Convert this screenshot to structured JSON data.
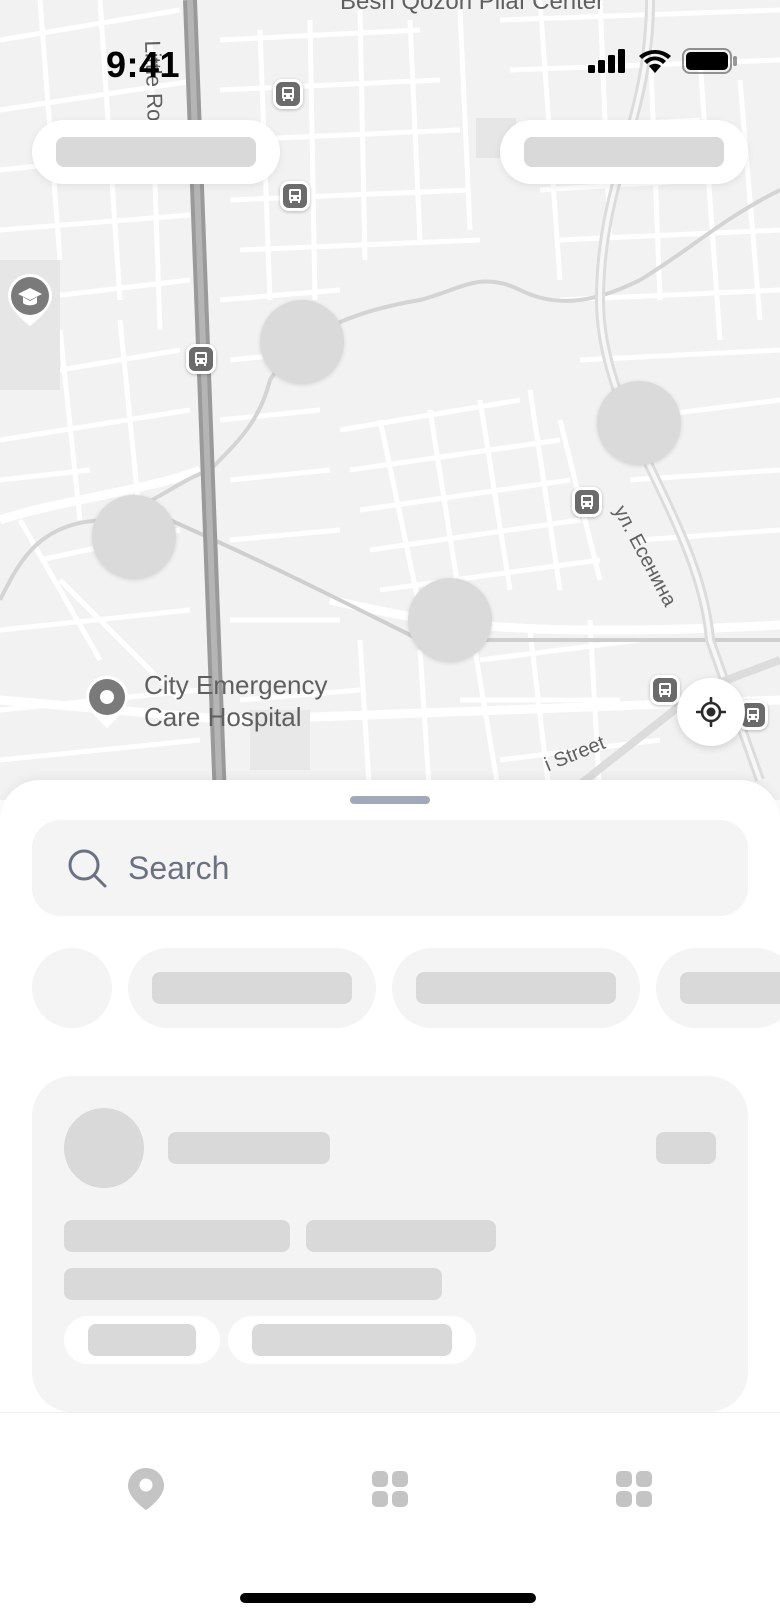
{
  "status_bar": {
    "time": "9:41"
  },
  "map": {
    "labels": {
      "hospital_line1": "City Emergency",
      "hospital_line2": "Care Hospital",
      "street_little": "Little Road",
      "street_esenina": "ул. Есенина",
      "street_bottom": "i Street",
      "top_center": "Besh Qozon Pilaf Center"
    },
    "icons": {
      "bus_stop": "bus-icon",
      "school": "graduation-cap-icon",
      "hospital": "location-pin-icon",
      "locate": "crosshair-icon"
    }
  },
  "sheet": {
    "search": {
      "placeholder": "Search",
      "icon": "search-icon"
    }
  },
  "tabbar": {
    "tabs": [
      {
        "icon": "map-pin-icon"
      },
      {
        "icon": "grid-icon"
      },
      {
        "icon": "grid-icon"
      }
    ]
  },
  "colors": {
    "map_background": "#f2f2f2",
    "skeleton": "#d9d9d9",
    "surface": "#f4f4f4",
    "placeholder_text": "#6b7183",
    "icon_gray": "#c4c4c4"
  }
}
